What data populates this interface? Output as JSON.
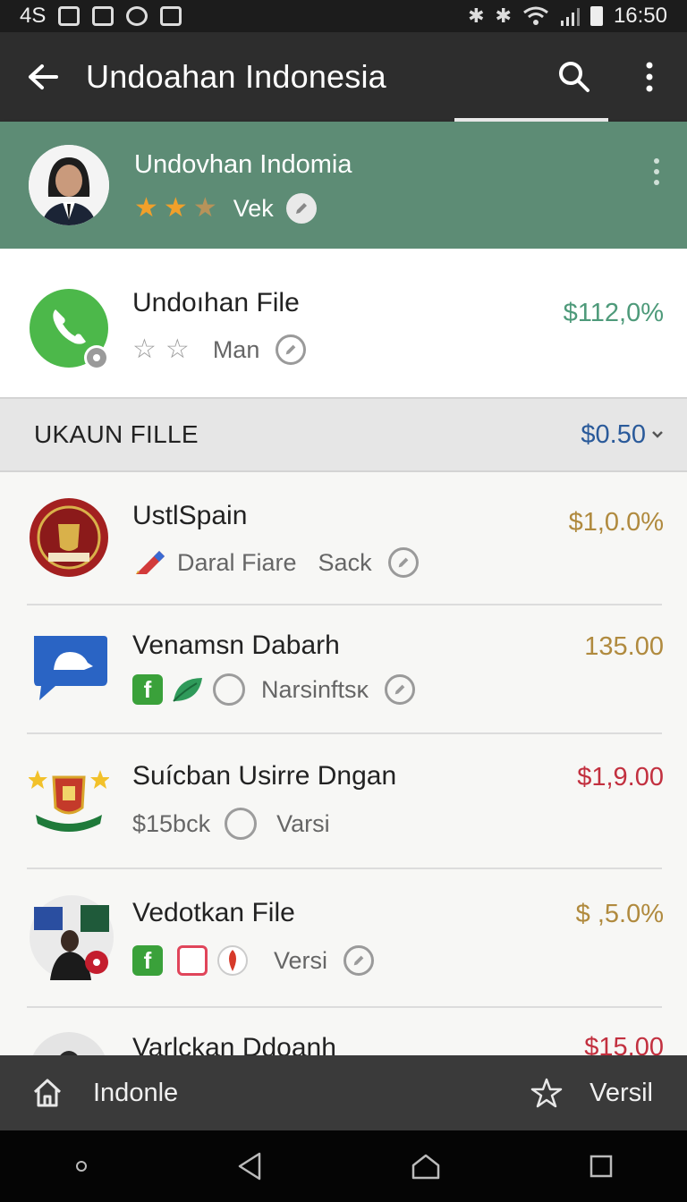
{
  "status_bar": {
    "left_text": "4S",
    "time": "16:50"
  },
  "app_bar": {
    "title": "Undoahan Indonesia",
    "icons": [
      "back-arrow-icon",
      "search-icon",
      "more-vert-icon"
    ]
  },
  "profile": {
    "name": "Undovhan Indomia",
    "rating": 2.5,
    "rating_label": "Vek"
  },
  "featured_item": {
    "title": "Undoıhan File",
    "rating_label": "Man",
    "price": "$112,0%",
    "price_color": "#4e9a7a"
  },
  "section": {
    "label": "UKAUN FILLE",
    "price": "$0.50",
    "price_color": "#2a5a9a"
  },
  "list": [
    {
      "title": "UstlSpain",
      "sub1": "Daral Fiare",
      "sub2": "Sack",
      "price": "$1,0.0%",
      "price_color": "#b08a3e"
    },
    {
      "title": "Venamsn Dabarh",
      "sub1": "Narsinftsĸ",
      "price": "135.00",
      "price_color": "#b08a3e"
    },
    {
      "title": "Suícban Usirre Dngan",
      "sub1": "$15bck",
      "sub2": "Varsi",
      "price": "$1,9.00",
      "price_color": "#c2303f"
    },
    {
      "title": "Vedotkan File",
      "sub1": "Versi",
      "price": "$ ,5.0%",
      "price_color": "#b08a3e"
    },
    {
      "title": "Varlckan Ddoanh",
      "price": "$15.00",
      "price_color": "#c2303f"
    }
  ],
  "bottom_nav": {
    "left_label": "Indonle",
    "right_label": "Versil"
  },
  "colors": {
    "appbar": "#2d2d2d",
    "profile_bg": "#5d8c75",
    "star": "#f1a02a"
  }
}
